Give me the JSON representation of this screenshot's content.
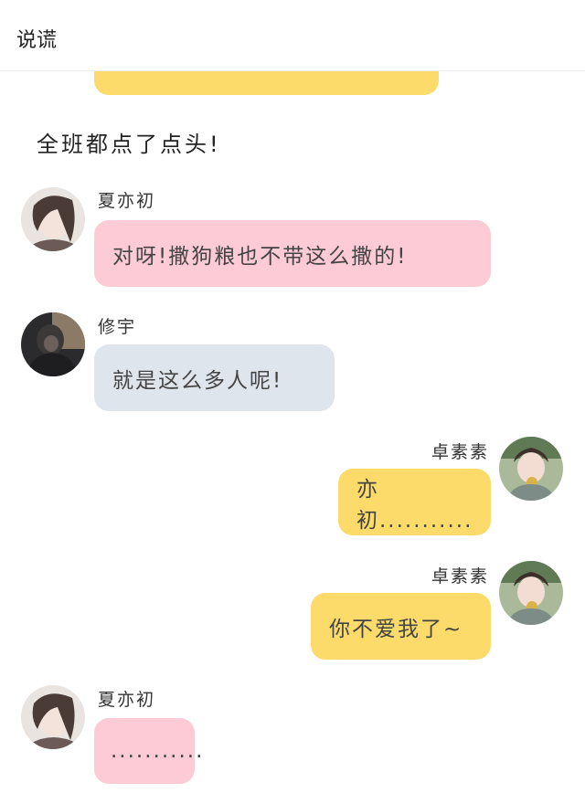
{
  "header": {
    "title": "说谎"
  },
  "messages": [
    {
      "side": "right",
      "sender": "",
      "text": ""
    },
    {
      "side": "narration",
      "text": "全班都点了点头!"
    },
    {
      "side": "left",
      "sender": "夏亦初",
      "text": "对呀!撒狗粮也不带这么撒的!"
    },
    {
      "side": "left",
      "sender": "修宇",
      "text": "就是这么多人呢!"
    },
    {
      "side": "right",
      "sender": "卓素素",
      "text": "亦初..........."
    },
    {
      "side": "right",
      "sender": "卓素素",
      "text": "你不爱我了~"
    },
    {
      "side": "left",
      "sender": "夏亦初",
      "text": "..........."
    }
  ],
  "colors": {
    "yellow_bubble": "#fcdb6a",
    "pink_bubble": "#fdcbd6",
    "blue_bubble": "#dee5ec"
  }
}
